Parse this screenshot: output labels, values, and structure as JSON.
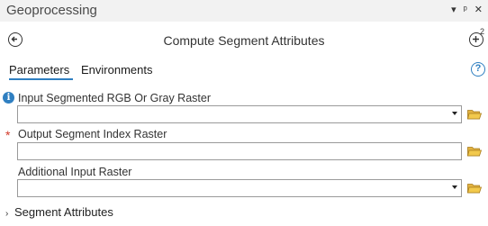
{
  "window": {
    "title": "Geoprocessing",
    "controls": {
      "dropdown_icon": "dropdown-icon",
      "pin_icon": "pin-icon",
      "close_icon": "close-icon"
    }
  },
  "nav": {
    "back_icon": "back-arrow-icon",
    "tool_title": "Compute Segment Attributes",
    "add_icon": "add-icon",
    "add_badge": "2"
  },
  "tabs": [
    {
      "label": "Parameters",
      "active": true
    },
    {
      "label": "Environments",
      "active": false
    }
  ],
  "help_icon": "help-icon",
  "fields": [
    {
      "label": "Input Segmented RGB Or Gray Raster",
      "value": "",
      "type": "dropdown",
      "indicator": "info",
      "browse_icon": "folder-icon"
    },
    {
      "label": "Output Segment Index Raster",
      "value": "",
      "type": "text",
      "indicator": "required",
      "browse_icon": "folder-icon"
    },
    {
      "label": "Additional Input Raster",
      "value": "",
      "type": "dropdown",
      "indicator": "",
      "browse_icon": "folder-icon"
    }
  ],
  "section": {
    "label": "Segment Attributes",
    "expanded": false
  }
}
